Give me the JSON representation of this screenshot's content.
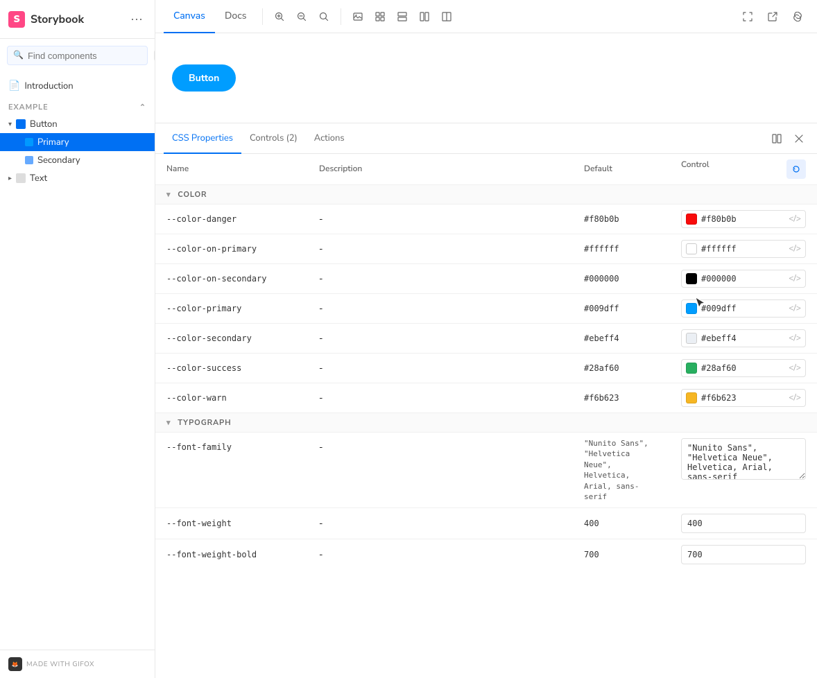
{
  "sidebar": {
    "logo_text": "S",
    "title": "Storybook",
    "menu_label": "•••",
    "search_placeholder": "Find components",
    "search_shortcut": "/",
    "intro_item": "Introduction",
    "section_label": "EXAMPLE",
    "group_name": "Button",
    "items": [
      {
        "label": "Primary",
        "active": true
      },
      {
        "label": "Secondary",
        "active": false
      }
    ],
    "text_group": "Text",
    "gifox_label": "MADE WITH GIFOX"
  },
  "toolbar": {
    "tabs": [
      {
        "label": "Canvas",
        "active": true
      },
      {
        "label": "Docs",
        "active": false
      }
    ],
    "icons": [
      "zoom-in",
      "zoom-out",
      "zoom-reset",
      "image",
      "grid",
      "layout1",
      "layout2",
      "layout3"
    ]
  },
  "preview": {
    "button_label": "Button"
  },
  "props_panel": {
    "tabs": [
      {
        "label": "CSS Properties",
        "active": true
      },
      {
        "label": "Controls (2)",
        "active": false
      },
      {
        "label": "Actions",
        "active": false
      }
    ],
    "table": {
      "headers": [
        "Name",
        "Description",
        "Default",
        "Control"
      ],
      "sections": [
        {
          "name": "COLOR",
          "rows": [
            {
              "name": "--color-danger",
              "description": "-",
              "default": "#f80b0b",
              "control_type": "color",
              "control_value": "#f80b0b",
              "swatch_class": "color-swatch-red"
            },
            {
              "name": "--color-on-primary",
              "description": "-",
              "default": "#ffffff",
              "control_type": "color",
              "control_value": "#ffffff",
              "swatch_class": "color-swatch-white"
            },
            {
              "name": "--color-on-secondary",
              "description": "-",
              "default": "#000000",
              "control_type": "color",
              "control_value": "#000000",
              "swatch_class": "color-swatch-black"
            },
            {
              "name": "--color-primary",
              "description": "-",
              "default": "#009dff",
              "control_type": "color",
              "control_value": "#009dff",
              "swatch_class": "color-swatch-blue"
            },
            {
              "name": "--color-secondary",
              "description": "-",
              "default": "#ebeff4",
              "control_type": "color",
              "control_value": "#ebeff4",
              "swatch_class": "color-swatch-lightblue"
            },
            {
              "name": "--color-success",
              "description": "-",
              "default": "#28af60",
              "control_type": "color",
              "control_value": "#28af60",
              "swatch_class": "color-swatch-green"
            },
            {
              "name": "--color-warn",
              "description": "-",
              "default": "#f6b623",
              "control_type": "color",
              "control_value": "#f6b623",
              "swatch_class": "color-swatch-orange"
            }
          ]
        },
        {
          "name": "TYPOGRAPH",
          "rows": [
            {
              "name": "--font-family",
              "description": "-",
              "default": "\"Nunito Sans\", \"Helvetica Neue\", Helvetica, Arial, sans-serif",
              "control_type": "textarea",
              "control_value": "\"Nunito Sans\", \"Helvetica Neue\", Helvetica, Arial, sans-serif"
            },
            {
              "name": "--font-weight",
              "description": "-",
              "default": "400",
              "control_type": "number",
              "control_value": "400"
            },
            {
              "name": "--font-weight-bold",
              "description": "-",
              "default": "700",
              "control_type": "number",
              "control_value": "700"
            }
          ]
        }
      ]
    }
  }
}
